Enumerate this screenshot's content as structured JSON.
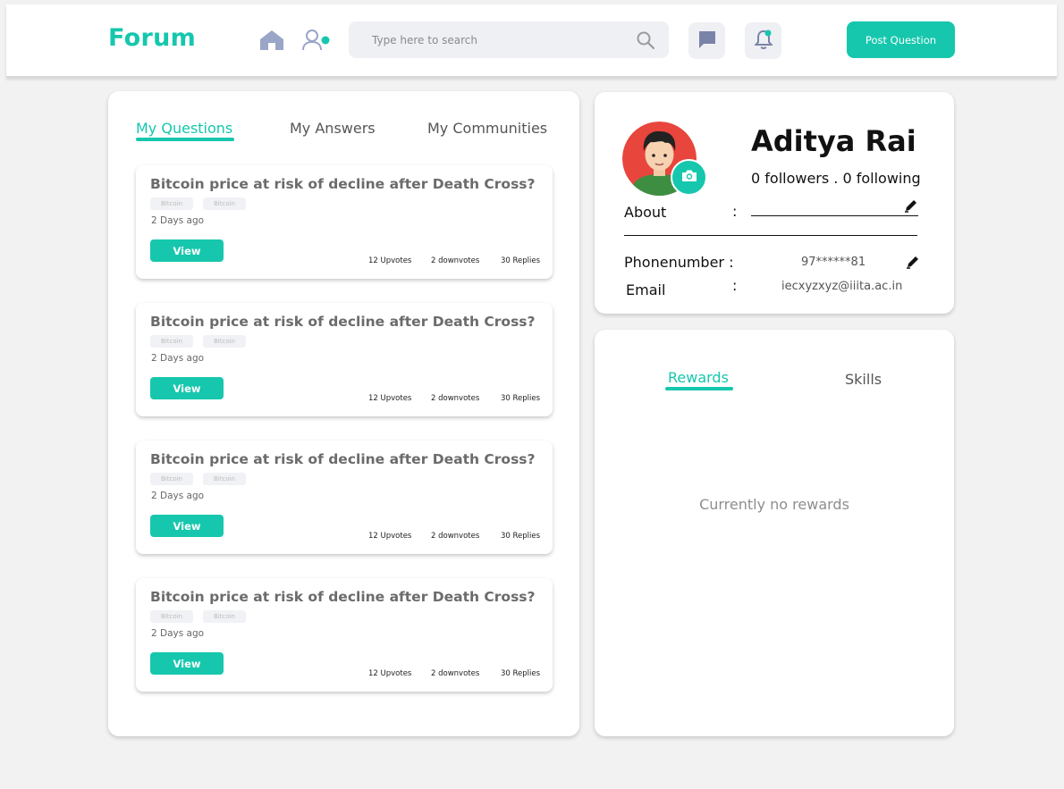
{
  "nav": {
    "logo": "Forum",
    "search_placeholder": "Type here to search",
    "post_button": "Post Question"
  },
  "tabs": {
    "questions": "My Questions",
    "answers": "My Answers",
    "communities": "My Communities"
  },
  "questions": [
    {
      "title": "Bitcoin price at risk of decline after Death Cross?",
      "tags": [
        "Bitcoin",
        "Bitcoin"
      ],
      "date": "2 Days ago",
      "view": "View",
      "upvotes": "12 Upvotes",
      "downvotes": "2 downvotes",
      "replies": "30 Replies"
    },
    {
      "title": "Bitcoin price at risk of decline after Death Cross?",
      "tags": [
        "Bitcoin",
        "Bitcoin"
      ],
      "date": "2 Days ago",
      "view": "View",
      "upvotes": "12 Upvotes",
      "downvotes": "2 downvotes",
      "replies": "30 Replies"
    },
    {
      "title": "Bitcoin price at risk of decline after Death Cross?",
      "tags": [
        "Bitcoin",
        "Bitcoin"
      ],
      "date": "2 Days ago",
      "view": "View",
      "upvotes": "12 Upvotes",
      "downvotes": "2 downvotes",
      "replies": "30 Replies"
    },
    {
      "title": "Bitcoin price at risk of decline after Death Cross?",
      "tags": [
        "Bitcoin",
        "Bitcoin"
      ],
      "date": "2 Days ago",
      "view": "View",
      "upvotes": "12 Upvotes",
      "downvotes": "2 downvotes",
      "replies": "30 Replies"
    }
  ],
  "profile": {
    "name": "Aditya Rai",
    "follow": "0 followers . 0 following",
    "about_label": "About",
    "phone_label": "Phonenumber :",
    "phone_value": "97******81",
    "email_label": "Email",
    "email_value": "iecxyzxyz@iiita.ac.in",
    "colon": ":"
  },
  "rewards": {
    "tab_rewards": "Rewards",
    "tab_skills": "Skills",
    "empty": "Currently no rewards"
  },
  "colors": {
    "accent": "#16c7ad",
    "background": "#f2f2f2",
    "avatar_bg": "#e8453c"
  },
  "icons": [
    "home-icon",
    "user-icon",
    "search-icon",
    "chat-icon",
    "bell-icon",
    "camera-icon",
    "pencil-icon"
  ]
}
